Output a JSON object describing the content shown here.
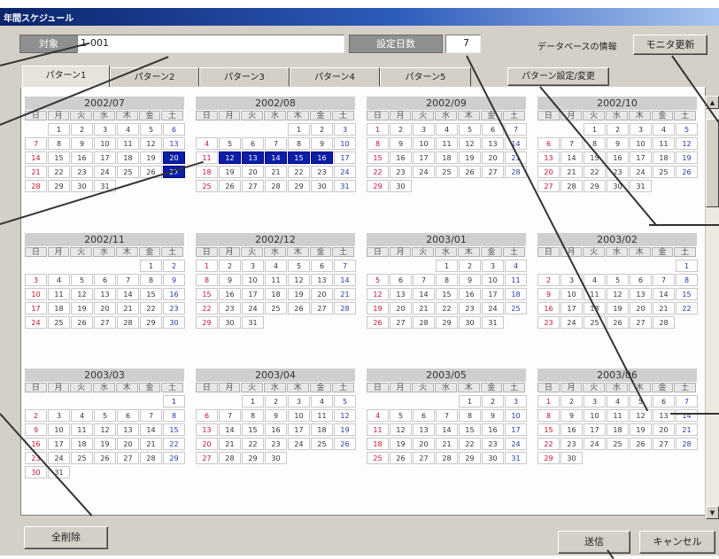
{
  "window": {
    "title": "年間スケジュール"
  },
  "header": {
    "target_label": "対象",
    "target_value": "1-001",
    "setdays_label": "設定日数",
    "setdays_value": "7",
    "db_info": "データベースの情報",
    "monitor_button": "モニタ更新"
  },
  "tabs": [
    "パターン1",
    "パターン2",
    "パターン3",
    "パターン4",
    "パターン5"
  ],
  "pattern_button": "パターン設定/変更",
  "weekday_headers": [
    "日",
    "月",
    "火",
    "水",
    "木",
    "金",
    "土"
  ],
  "months": [
    {
      "title": "2002/07",
      "offset": 1,
      "days": 31,
      "selected": [
        20,
        27
      ]
    },
    {
      "title": "2002/08",
      "offset": 4,
      "days": 31,
      "selected": [
        12,
        13,
        14,
        15,
        16
      ]
    },
    {
      "title": "2002/09",
      "offset": 0,
      "days": 30,
      "selected": []
    },
    {
      "title": "2002/10",
      "offset": 2,
      "days": 31,
      "selected": []
    },
    {
      "title": "2002/11",
      "offset": 5,
      "days": 30,
      "selected": []
    },
    {
      "title": "2002/12",
      "offset": 0,
      "days": 31,
      "selected": []
    },
    {
      "title": "2003/01",
      "offset": 3,
      "days": 31,
      "selected": []
    },
    {
      "title": "2003/02",
      "offset": 6,
      "days": 28,
      "selected": []
    },
    {
      "title": "2003/03",
      "offset": 6,
      "days": 31,
      "selected": []
    },
    {
      "title": "2003/04",
      "offset": 2,
      "days": 30,
      "selected": []
    },
    {
      "title": "2003/05",
      "offset": 4,
      "days": 31,
      "selected": []
    },
    {
      "title": "2003/06",
      "offset": 0,
      "days": 30,
      "selected": []
    }
  ],
  "footer": {
    "clear_all": "全削除",
    "send": "送信",
    "cancel": "キャンセル"
  }
}
